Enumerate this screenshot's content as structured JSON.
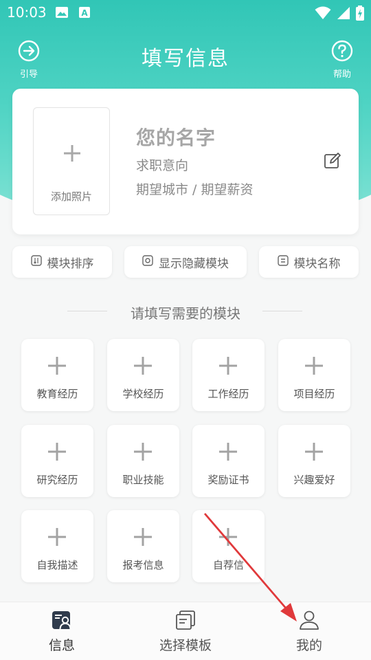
{
  "status_bar": {
    "time": "10:03"
  },
  "topnav": {
    "title": "填写信息",
    "left_label": "引导",
    "right_label": "帮助"
  },
  "profile": {
    "add_photo": "添加照片",
    "name": "您的名字",
    "intent": "求职意向",
    "city_salary": "期望城市 / 期望薪资"
  },
  "actions": [
    {
      "label": "模块排序",
      "icon": "sort-icon"
    },
    {
      "label": "显示隐藏模块",
      "icon": "eye-toggle-icon"
    },
    {
      "label": "模块名称",
      "icon": "rename-icon"
    }
  ],
  "section": {
    "title": "请填写需要的模块"
  },
  "modules": [
    {
      "label": "教育经历"
    },
    {
      "label": "学校经历"
    },
    {
      "label": "工作经历"
    },
    {
      "label": "项目经历"
    },
    {
      "label": "研究经历"
    },
    {
      "label": "职业技能"
    },
    {
      "label": "奖励证书"
    },
    {
      "label": "兴趣爱好"
    },
    {
      "label": "自我描述"
    },
    {
      "label": "报考信息"
    },
    {
      "label": "自荐信"
    }
  ],
  "bottom_nav": [
    {
      "label": "信息",
      "active": true
    },
    {
      "label": "选择模板",
      "active": false
    },
    {
      "label": "我的",
      "active": false
    }
  ],
  "colors": {
    "header_teal": "#31c6b6",
    "annotation_arrow": "#e0393b"
  }
}
